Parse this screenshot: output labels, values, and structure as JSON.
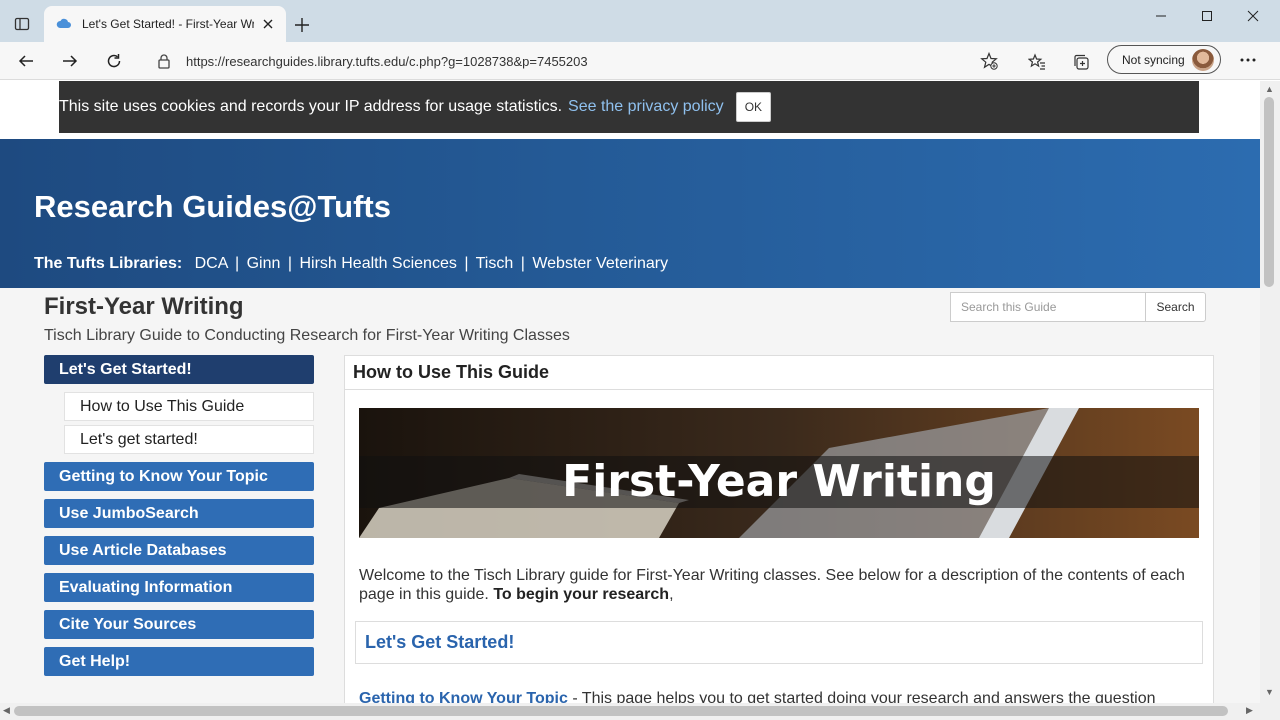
{
  "browser": {
    "tab_title": "Let's Get Started! - First-Year Wri",
    "url": "https://researchguides.library.tufts.edu/c.php?g=1028738&p=7455203",
    "profile_label": "Not syncing"
  },
  "cookie": {
    "text": "This site uses cookies and records your IP address for usage statistics.",
    "link": "See the privacy policy",
    "ok": "OK"
  },
  "header": {
    "site_title": "Research Guides@Tufts",
    "libraries_label": "The Tufts Libraries:",
    "libraries": [
      "DCA",
      "Ginn",
      "Hirsh Health Sciences",
      "Tisch",
      "Webster Veterinary"
    ],
    "separator": "|"
  },
  "guide": {
    "title": "First-Year Writing",
    "description": "Tisch Library Guide to Conducting Research for First-Year Writing Classes",
    "search_placeholder": "Search this Guide",
    "search_button": "Search"
  },
  "sidenav": {
    "active": "Let's Get Started!",
    "subitems": [
      "How to Use This Guide",
      "Let's get started!"
    ],
    "items": [
      "Getting to Know Your Topic",
      "Use JumboSearch",
      "Use Article Databases",
      "Evaluating Information",
      "Cite Your Sources",
      "Get Help!"
    ]
  },
  "content": {
    "box_title": "How to Use This Guide",
    "banner_text": "First-Year Writing",
    "welcome": "Welcome to the Tisch Library guide for First-Year Writing classes. See below for a description of the contents of each page in this guide.",
    "welcome_bold": "To begin your research",
    "welcome_tail": ",",
    "inner_link": "Let's Get Started!",
    "next_link": "Getting to Know Your Topic",
    "next_text": " - This page helps you to get started doing your research and answers the question"
  }
}
